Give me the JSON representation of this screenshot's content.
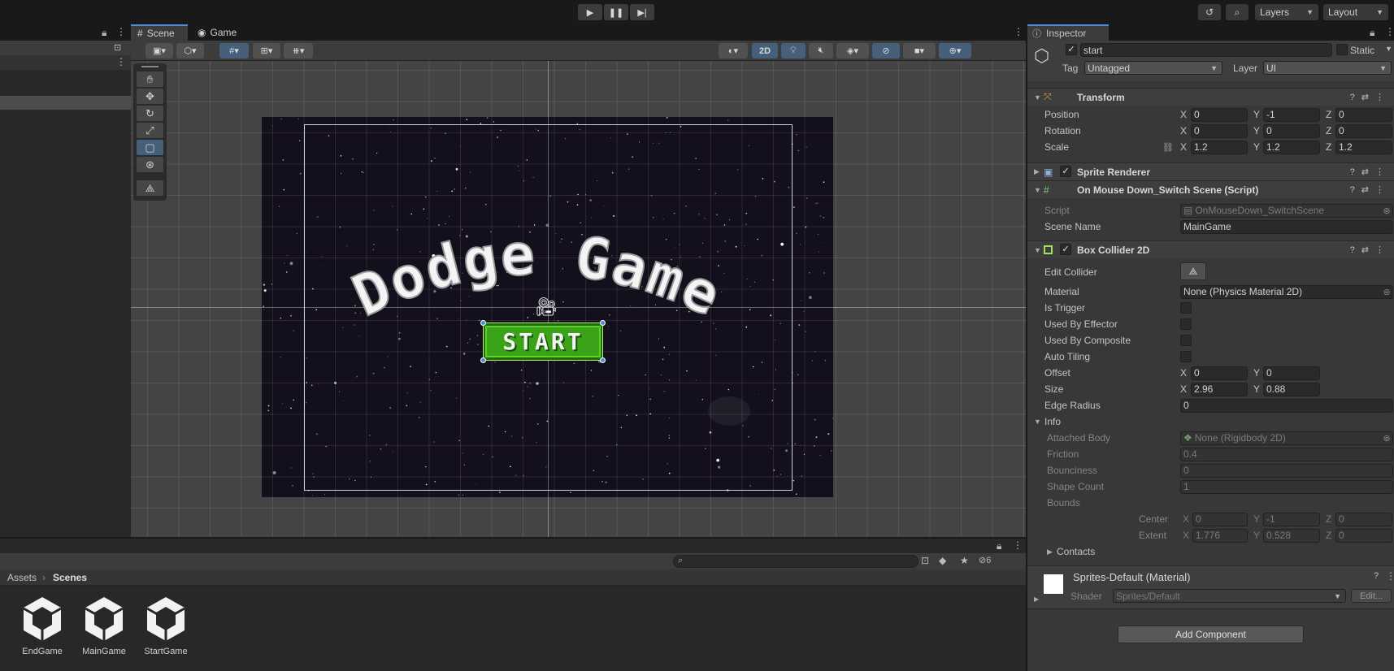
{
  "toolbar": {
    "layers_label": "Layers",
    "layout_label": "Layout"
  },
  "scene_tabs": [
    {
      "label": "Scene"
    },
    {
      "label": "Game"
    }
  ],
  "scene_toolbar": {
    "mode_2d": "2D"
  },
  "game_preview": {
    "title": "Dodge Game",
    "button_label": "START"
  },
  "project": {
    "breadcrumb_root": "Assets",
    "breadcrumb_current": "Scenes",
    "hidden_count": "6",
    "assets": [
      {
        "name": "EndGame"
      },
      {
        "name": "MainGame"
      },
      {
        "name": "StartGame"
      }
    ]
  },
  "inspector": {
    "tab_label": "Inspector",
    "object_name": "start",
    "static_label": "Static",
    "tag_label": "Tag",
    "tag_value": "Untagged",
    "layer_label": "Layer",
    "layer_value": "UI",
    "transform": {
      "title": "Transform",
      "position_label": "Position",
      "rotation_label": "Rotation",
      "scale_label": "Scale",
      "position": {
        "x": "0",
        "y": "-1",
        "z": "0"
      },
      "rotation": {
        "x": "0",
        "y": "0",
        "z": "0"
      },
      "scale": {
        "x": "1.2",
        "y": "1.2",
        "z": "1.2"
      }
    },
    "sprite_renderer": {
      "title": "Sprite Renderer"
    },
    "script_component": {
      "title": "On Mouse Down_Switch Scene (Script)",
      "script_label": "Script",
      "script_value": "OnMouseDown_SwitchScene",
      "scene_name_label": "Scene Name",
      "scene_name_value": "MainGame"
    },
    "box_collider": {
      "title": "Box Collider 2D",
      "edit_collider_label": "Edit Collider",
      "material_label": "Material",
      "material_value": "None (Physics Material 2D)",
      "is_trigger_label": "Is Trigger",
      "used_by_effector_label": "Used By Effector",
      "used_by_composite_label": "Used By Composite",
      "auto_tiling_label": "Auto Tiling",
      "offset_label": "Offset",
      "offset": {
        "x": "0",
        "y": "0"
      },
      "size_label": "Size",
      "size": {
        "x": "2.96",
        "y": "0.88"
      },
      "edge_radius_label": "Edge Radius",
      "edge_radius_value": "0",
      "info_label": "Info",
      "attached_body_label": "Attached Body",
      "attached_body_value": "None (Rigidbody 2D)",
      "friction_label": "Friction",
      "friction_value": "0.4",
      "bounciness_label": "Bounciness",
      "bounciness_value": "0",
      "shape_count_label": "Shape Count",
      "shape_count_value": "1",
      "bounds_label": "Bounds",
      "center_label": "Center",
      "center": {
        "x": "0",
        "y": "-1",
        "z": "0"
      },
      "extent_label": "Extent",
      "extent": {
        "x": "1.776",
        "y": "0.528",
        "z": "0"
      },
      "contacts_label": "Contacts"
    },
    "material": {
      "title": "Sprites-Default (Material)",
      "shader_label": "Shader",
      "shader_value": "Sprites/Default",
      "edit_label": "Edit..."
    },
    "add_component_label": "Add Component"
  },
  "axes": {
    "x": "X",
    "y": "Y",
    "z": "Z"
  },
  "colors": {
    "accent_blue": "#46607c",
    "start_button_green": "#3aa317",
    "collider_green": "#b4f06c"
  }
}
